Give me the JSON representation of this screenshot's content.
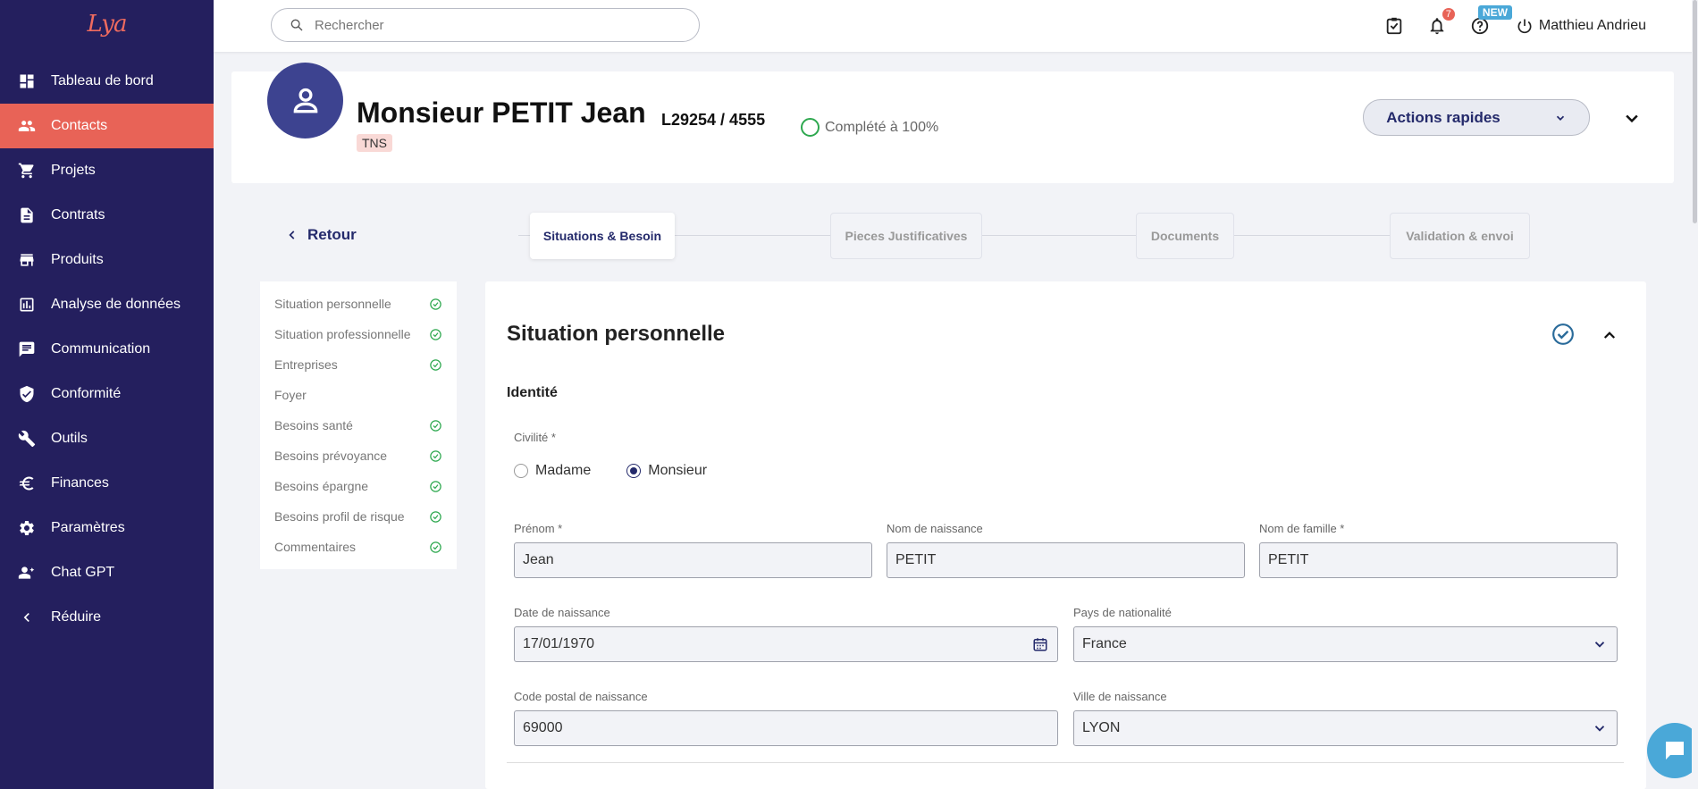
{
  "app": {
    "logo_text": "Lya"
  },
  "sidebar": {
    "items": [
      {
        "label": "Tableau de bord",
        "icon": "dashboard-icon"
      },
      {
        "label": "Contacts",
        "icon": "people-icon",
        "active": true
      },
      {
        "label": "Projets",
        "icon": "cart-icon"
      },
      {
        "label": "Contrats",
        "icon": "document-icon"
      },
      {
        "label": "Produits",
        "icon": "store-icon"
      },
      {
        "label": "Analyse de données",
        "icon": "analytics-icon"
      },
      {
        "label": "Communication",
        "icon": "chat-icon"
      },
      {
        "label": "Conformité",
        "icon": "shield-check-icon"
      },
      {
        "label": "Outils",
        "icon": "tools-icon"
      },
      {
        "label": "Finances",
        "icon": "euro-icon"
      },
      {
        "label": "Paramètres",
        "icon": "gear-icon"
      },
      {
        "label": "Chat GPT",
        "icon": "ai-person-icon"
      },
      {
        "label": "Réduire",
        "icon": "chevron-left-icon"
      }
    ]
  },
  "topbar": {
    "search_placeholder": "Rechercher",
    "notification_count": "7",
    "new_badge": "NEW",
    "user_name": "Matthieu Andrieu"
  },
  "contact": {
    "name": "Monsieur PETIT Jean",
    "ref": "L29254 / 4555",
    "tag": "TNS",
    "completion": "Complété à 100%",
    "actions_label": "Actions rapides"
  },
  "nav": {
    "back_label": "Retour",
    "steps": [
      "Situations & Besoin",
      "Pieces Justificatives",
      "Documents",
      "Validation & envoi"
    ]
  },
  "sections": [
    {
      "label": "Situation personnelle",
      "done": true
    },
    {
      "label": "Situation professionnelle",
      "done": true
    },
    {
      "label": "Entreprises",
      "done": true
    },
    {
      "label": "Foyer",
      "done": false
    },
    {
      "label": "Besoins santé",
      "done": true
    },
    {
      "label": "Besoins prévoyance",
      "done": true
    },
    {
      "label": "Besoins épargne",
      "done": true
    },
    {
      "label": "Besoins profil de risque",
      "done": true
    },
    {
      "label": "Commentaires",
      "done": true
    }
  ],
  "form": {
    "title": "Situation personnelle",
    "subheading": "Identité",
    "civility_label": "Civilité *",
    "civility_options": [
      "Madame",
      "Monsieur"
    ],
    "civility_selected": "Monsieur",
    "prenom_label": "Prénom *",
    "prenom_value": "Jean",
    "nom_naissance_label": "Nom de naissance",
    "nom_naissance_value": "PETIT",
    "nom_famille_label": "Nom de famille *",
    "nom_famille_value": "PETIT",
    "date_label": "Date de naissance",
    "date_value": "17/01/1970",
    "pays_label": "Pays de nationalité",
    "pays_value": "France",
    "cp_label": "Code postal de naissance",
    "cp_value": "69000",
    "ville_label": "Ville de naissance",
    "ville_value": "LYON"
  },
  "colors": {
    "sidebar_bg": "#241f5e",
    "accent": "#e86357",
    "success": "#2ea84f",
    "primary_text": "#242a6b"
  }
}
